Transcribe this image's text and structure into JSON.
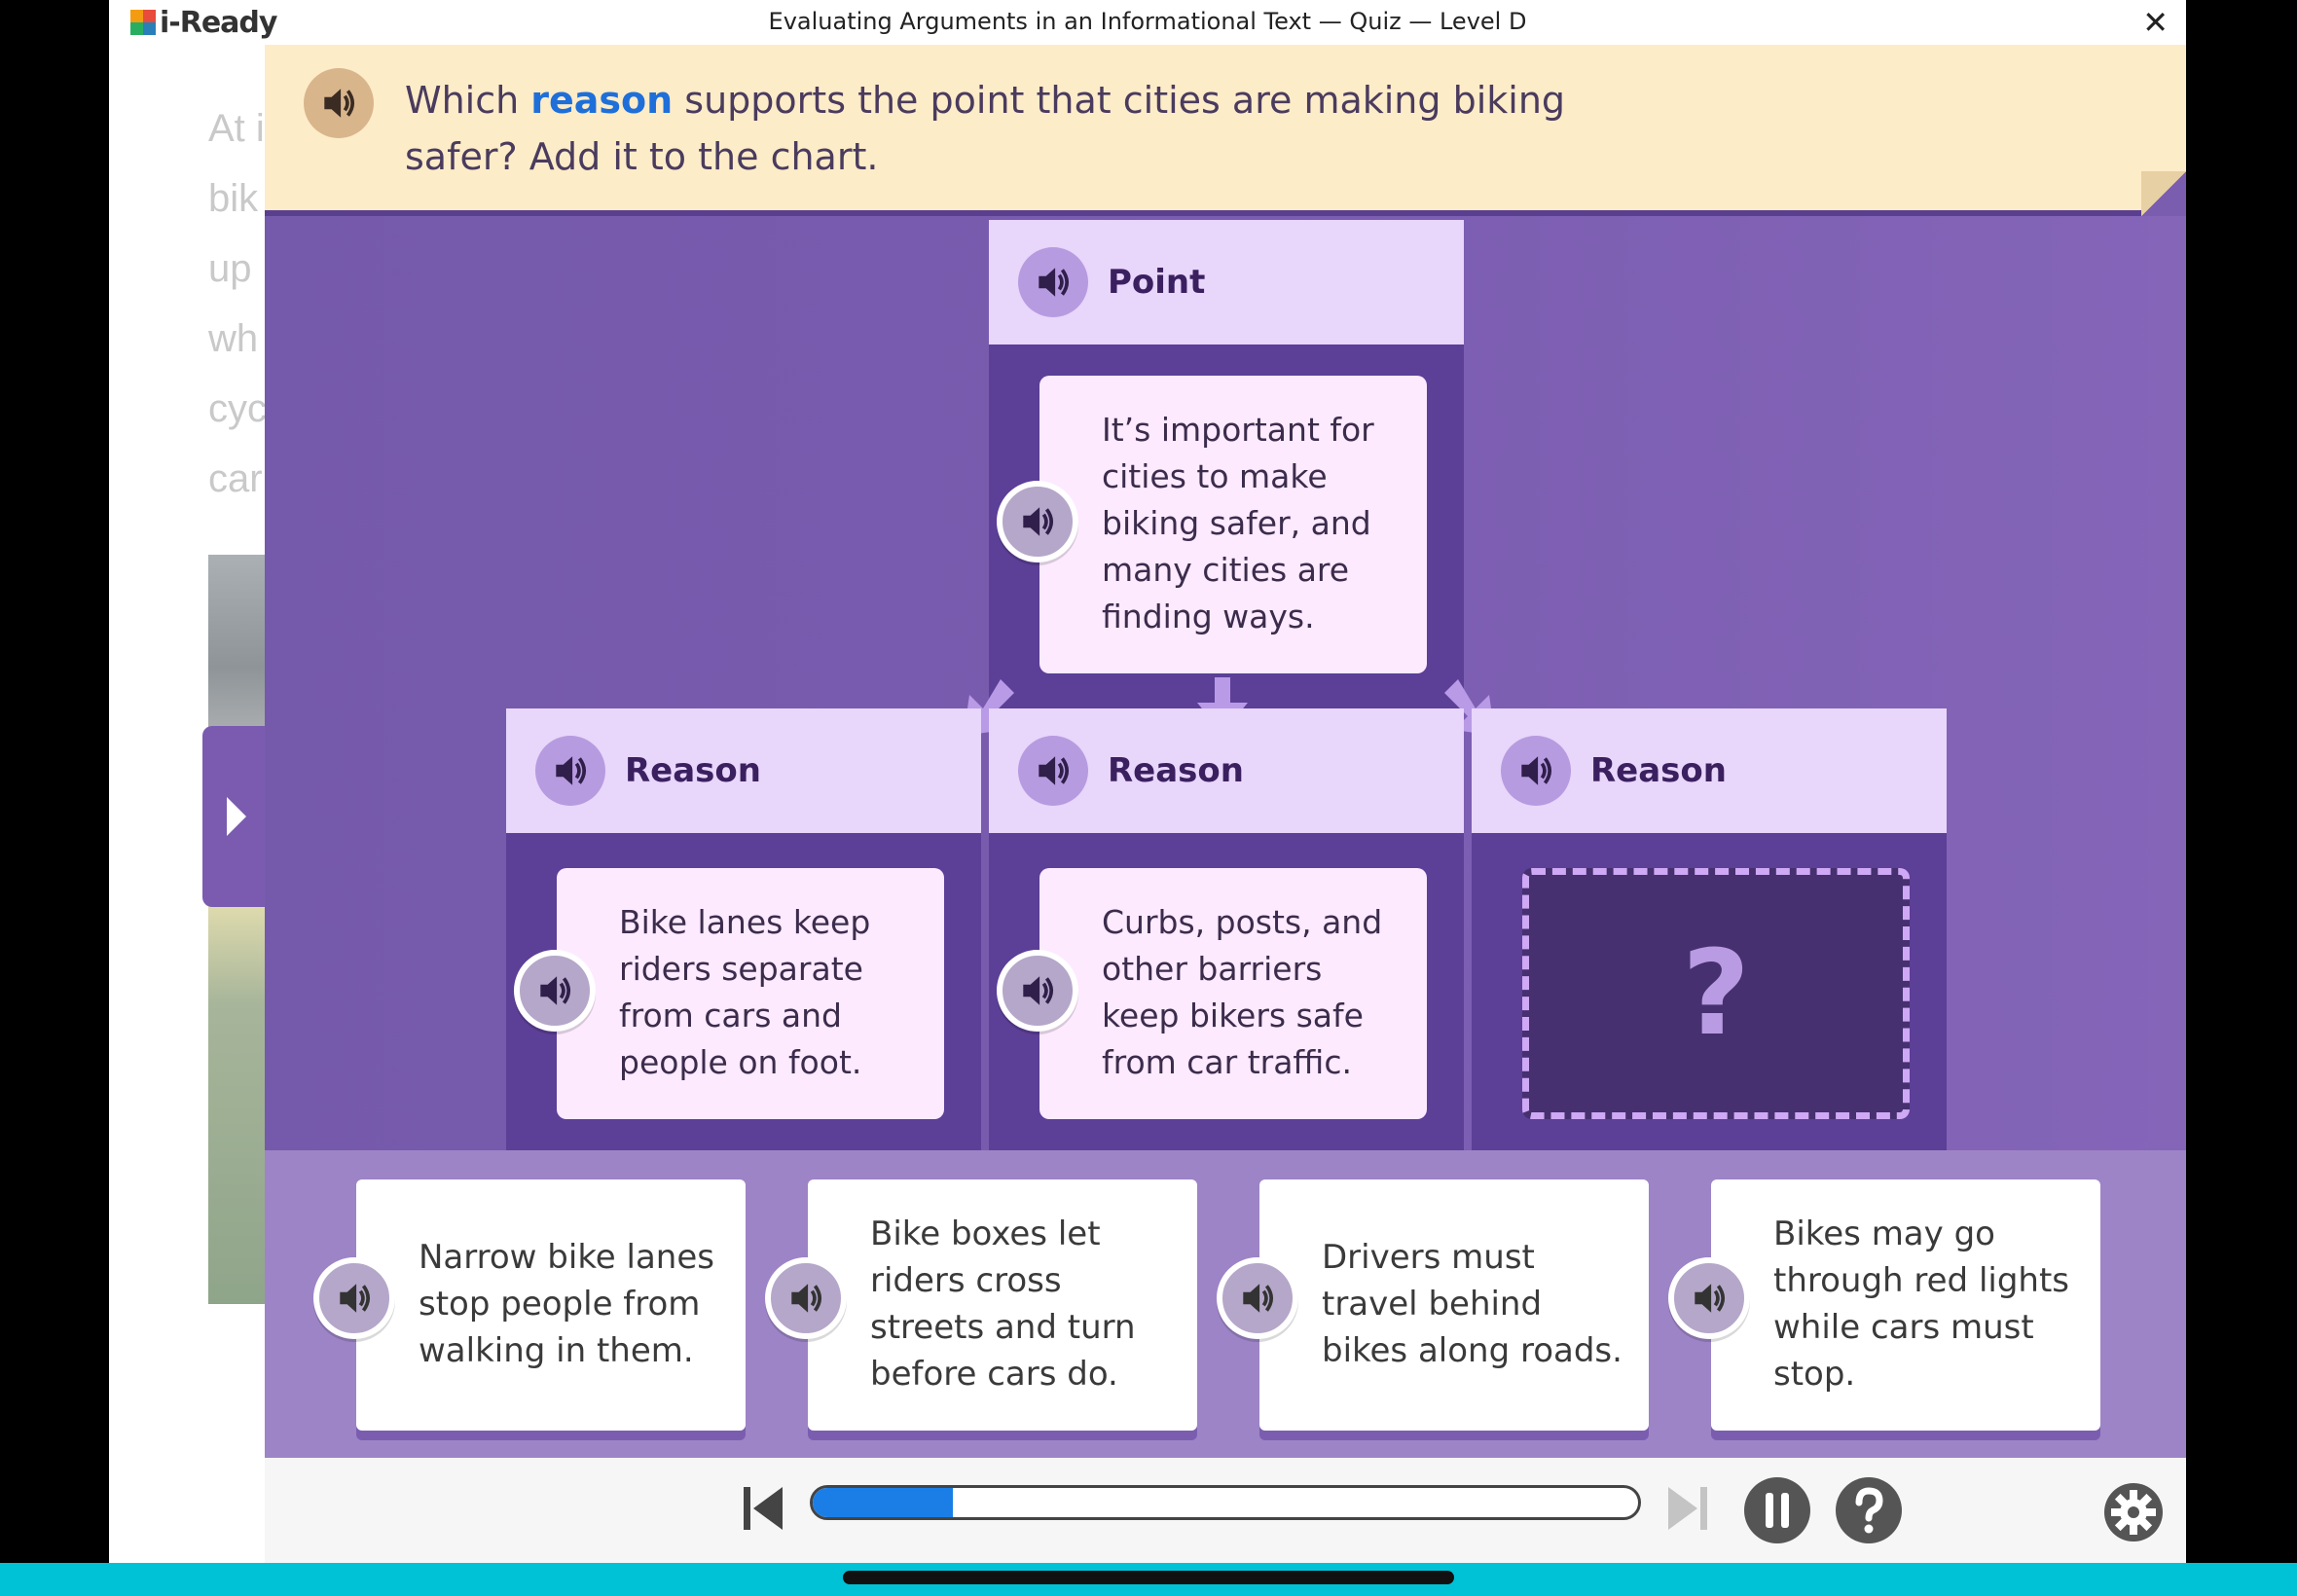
{
  "window": {
    "app_name": "i-Ready",
    "title": "Evaluating Arguments in an Informational Text — Quiz — Level D",
    "close_label": "✕"
  },
  "passage": {
    "lines": [
      "At i",
      "bik",
      "up",
      "wh",
      "cyc",
      "car"
    ]
  },
  "prompt": {
    "before": "Which ",
    "keyword": "reason",
    "after": " supports the point that cities are making biking safer? Add it to the chart."
  },
  "chart": {
    "point": {
      "header": "Point",
      "text": "It’s important for cities to make biking safer, and many cities are finding ways."
    },
    "reasons": [
      {
        "header": "Reason",
        "text": "Bike lanes keep riders separate from cars and people on foot."
      },
      {
        "header": "Reason",
        "text": "Curbs, posts, and other barriers keep bikers safe from car traffic."
      },
      {
        "header": "Reason",
        "text": ""
      }
    ],
    "drop_placeholder": "?"
  },
  "choices": [
    {
      "text": "Narrow bike lanes stop people from walking in them."
    },
    {
      "text": "Bike boxes let riders cross streets and turn before cars do."
    },
    {
      "text": "Drivers must travel behind bikes along roads."
    },
    {
      "text": "Bikes may go through red lights while cars must stop."
    }
  ],
  "footer": {
    "progress_fraction": 0.17
  },
  "colors": {
    "accent_blue": "#1e6fd9",
    "chart_purple": "#7b5db0",
    "header_lavender": "#e8d6fb",
    "prompt_bg": "#fdecc8",
    "bottom_bar": "#00c2d6"
  },
  "icons": [
    "i-ready-logo-icon",
    "close-icon",
    "speaker-icon",
    "chevron-right-icon",
    "skip-back-icon",
    "skip-forward-icon",
    "pause-icon",
    "help-icon",
    "gear-icon"
  ]
}
